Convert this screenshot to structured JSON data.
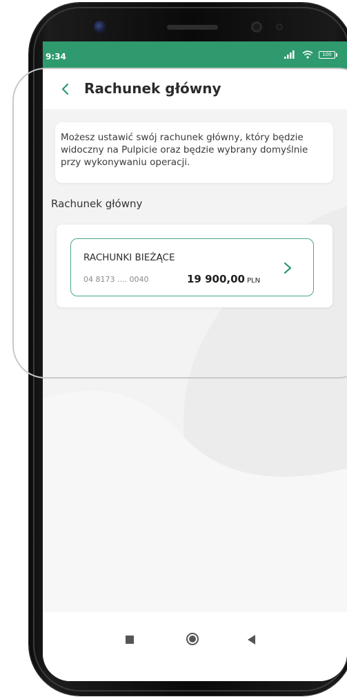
{
  "status_bar": {
    "time": "9:34",
    "battery_label": "100"
  },
  "header": {
    "title": "Rachunek główny",
    "back_icon": "chevron-left-icon"
  },
  "info": {
    "text": "Możesz ustawić swój rachunek główny, który będzie widoczny na Pulpicie oraz będzie wybrany domyślnie przy wykonywaniu operacji."
  },
  "section": {
    "label": "Rachunek główny"
  },
  "account": {
    "category": "RACHUNKI BIEŻĄCE",
    "number": "04 8173 .... 0040",
    "amount": "19 900,00",
    "currency": "PLN",
    "chevron_icon": "chevron-right-icon"
  },
  "navbar": {
    "recent_icon": "square-icon",
    "home_icon": "circle-icon",
    "back_icon": "triangle-left-icon"
  },
  "colors": {
    "brand_green": "#2f9a6e",
    "accent": "#4aa787",
    "screen_bg": "#f3f3f3"
  }
}
